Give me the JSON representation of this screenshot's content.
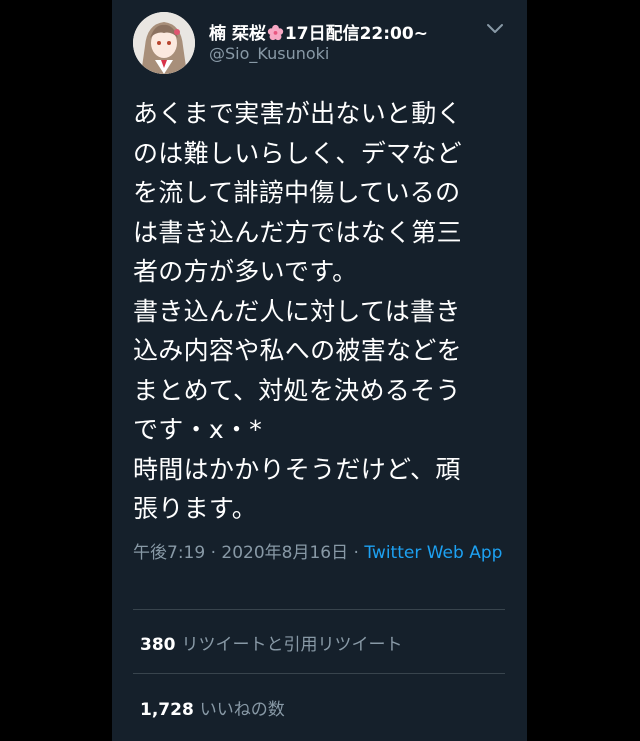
{
  "author": {
    "name_before": "楠 栞桜",
    "name_after": "17日配信22:00~",
    "handle": "@Sio_Kusunoki",
    "avatar_icon": "profile-avatar-icon",
    "flower_icon": "cherry-blossom-emoji"
  },
  "tweet": {
    "text": "あくまで実害が出ないと動く\nのは難しいらしく、デマなど\nを流して誹謗中傷しているの\nは書き込んだ方ではなく第三\n者の方が多いです。\n書き込んだ人に対しては書き\n込み内容や私への被害などを\nまとめて、対処を決めるそう\nです・x・*\n時間はかかりそうだけど、頑\n張ります。",
    "time": "午後7:19",
    "sep1": " · ",
    "date": "2020年8月16日",
    "sep2": " · ",
    "source": "Twitter Web App"
  },
  "stats": {
    "retweets": {
      "count": "380",
      "label": "リツイートと引用リツイート"
    },
    "likes": {
      "count": "1,728",
      "label": "いいねの数"
    }
  },
  "colors": {
    "background": "#15202b",
    "outer": "#000000",
    "text": "#ffffff",
    "secondary": "#8899a6",
    "link": "#1da1f2",
    "divider": "#38444d"
  }
}
